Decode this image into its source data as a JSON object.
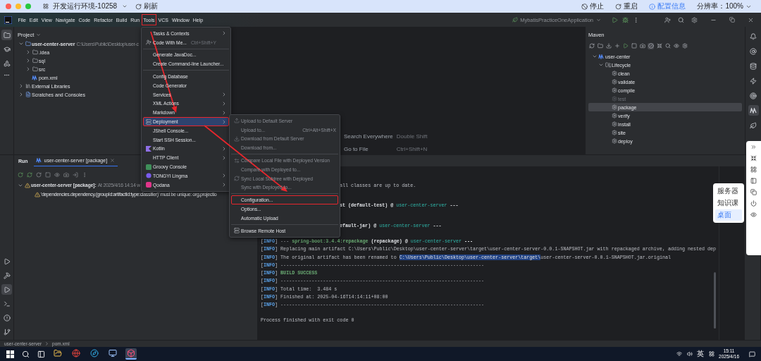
{
  "topbar": {
    "title": "开发运行环境-10258",
    "refresh": "刷新",
    "actions": [
      {
        "label": "停止",
        "kind": "stop"
      },
      {
        "label": "重启",
        "kind": "restart"
      },
      {
        "label": "配置信息",
        "kind": "info"
      }
    ],
    "resolution": "分辨率：100%"
  },
  "menubar": [
    {
      "label": "File",
      "highlighted": false
    },
    {
      "label": "Edit",
      "highlighted": false
    },
    {
      "label": "View",
      "highlighted": false
    },
    {
      "label": "Navigate",
      "highlighted": false
    },
    {
      "label": "Code",
      "highlighted": false
    },
    {
      "label": "Refactor",
      "highlighted": false
    },
    {
      "label": "Build",
      "highlighted": false
    },
    {
      "label": "Run",
      "highlighted": false
    },
    {
      "label": "Tools",
      "highlighted": true
    },
    {
      "label": "VCS",
      "highlighted": false
    },
    {
      "label": "Window",
      "highlighted": false
    },
    {
      "label": "Help",
      "highlighted": false
    }
  ],
  "run_config": "MybatisPracticeOneApplication",
  "left_tools": {
    "top": [
      {
        "selected": true
      },
      {
        "selected": false
      },
      {
        "selected": false
      }
    ],
    "bottom": [
      {
        "selected": false
      },
      {
        "selected": false
      },
      {
        "selected": true
      },
      {
        "selected": false
      },
      {
        "selected": false
      },
      {
        "selected": false
      }
    ]
  },
  "project": {
    "title": "Project",
    "tree": [
      {
        "label": "user-center-server",
        "hint": "C:\\Users\\Public\\Desktop\\user-c",
        "kind": "module",
        "expanded": true,
        "children": [
          {
            "label": ".idea",
            "kind": "folder",
            "expanded": false
          },
          {
            "label": "sql",
            "kind": "folder",
            "expanded": false
          },
          {
            "label": "src",
            "kind": "folder",
            "expanded": false
          },
          {
            "label": "pom.xml",
            "kind": "file"
          }
        ]
      },
      {
        "label": "External Libraries",
        "kind": "library",
        "expanded": false
      },
      {
        "label": "Scratches and Consoles",
        "kind": "scratches",
        "expanded": false
      }
    ]
  },
  "editor_hints": [
    {
      "action": "Search Everywhere",
      "shortcut": "Double Shift"
    },
    {
      "action": "Go to File",
      "shortcut": "Ctrl+Shift+N"
    }
  ],
  "maven": {
    "title": "Maven",
    "tree": [
      {
        "label": "user-center",
        "kind": "module",
        "expanded": true,
        "children": [
          {
            "label": "Lifecycle",
            "kind": "folder",
            "expanded": true,
            "children": [
              {
                "label": "clean",
                "kind": "goal",
                "selected": false,
                "disabled": false
              },
              {
                "label": "validate",
                "kind": "goal",
                "selected": false,
                "disabled": false
              },
              {
                "label": "compile",
                "kind": "goal",
                "selected": false,
                "disabled": false
              },
              {
                "label": "test",
                "kind": "goal",
                "selected": false,
                "disabled": true
              },
              {
                "label": "package",
                "kind": "goal",
                "selected": true,
                "disabled": false
              },
              {
                "label": "verify",
                "kind": "goal",
                "selected": false,
                "disabled": false
              },
              {
                "label": "install",
                "kind": "goal",
                "selected": false,
                "disabled": false
              },
              {
                "label": "site",
                "kind": "goal",
                "selected": false,
                "disabled": false
              },
              {
                "label": "deploy",
                "kind": "goal",
                "selected": false,
                "disabled": false
              }
            ]
          }
        ]
      }
    ]
  },
  "right_tools": [
    {
      "selected": false
    },
    {
      "selected": false
    },
    {
      "selected": false
    },
    {
      "selected": false
    },
    {
      "selected": false
    },
    {
      "selected": true
    },
    {
      "selected": false
    }
  ],
  "run": {
    "label": "Run",
    "tab": "user-center-server [package]",
    "tree": {
      "title": "user-center-server [package]:",
      "meta": "At 2025/4/16 14:14 w",
      "expanded": true,
      "children": [
        {
          "message": "'dependencies.dependency.(groupId:artifactId:type:classifier)' must be unique: org.projectio"
        }
      ]
    },
    "console": {
      "partial_lines": [
        [
          {
            "text": "all classes are up to date.",
            "kind": "plain"
          }
        ],
        [
          {
            "text": "st (default-test) @ ",
            "kind": "bold"
          },
          {
            "text": "user-center-server",
            "kind": "cyan"
          },
          {
            "text": " ---",
            "kind": "bold"
          }
        ],
        [
          {
            "text": "efault-jar) @ ",
            "kind": "bold"
          },
          {
            "text": "user-center-server",
            "kind": "cyan"
          },
          {
            "text": " ---",
            "kind": "bold"
          }
        ]
      ],
      "lines": [
        [
          {
            "text": "[",
            "kind": "plain"
          },
          {
            "text": "INFO",
            "kind": "tag"
          },
          {
            "text": "] --- ",
            "kind": "plain"
          },
          {
            "text": "spring-boot:3.4.4:repackage",
            "kind": "green"
          },
          {
            "text": " (repackage) @ ",
            "kind": "bold"
          },
          {
            "text": "user-center-server",
            "kind": "cyan"
          },
          {
            "text": " ---",
            "kind": "bold"
          }
        ],
        [
          {
            "text": "[",
            "kind": "plain"
          },
          {
            "text": "INFO",
            "kind": "tag"
          },
          {
            "text": "] Replacing main artifact C:\\Users\\Public\\Desktop\\user-center-server\\target\\user-center-server-0.0.1-SNAPSHOT.jar with repackaged archive, adding nested dep",
            "kind": "plain"
          }
        ],
        [
          {
            "text": "[",
            "kind": "plain"
          },
          {
            "text": "INFO",
            "kind": "tag"
          },
          {
            "text": "] The original artifact has been renamed to ",
            "kind": "plain"
          },
          {
            "text": "C:\\Users\\Public\\Desktop\\user-center-server\\target\\",
            "kind": "selected"
          },
          {
            "text": "user-center-server-0.0.1-SNAPSHOT.jar.original",
            "kind": "plain"
          }
        ],
        [
          {
            "text": "[",
            "kind": "plain"
          },
          {
            "text": "INFO",
            "kind": "tag"
          },
          {
            "text": "] ------------------------------------------------------------------------",
            "kind": "plain"
          }
        ],
        [
          {
            "text": "[",
            "kind": "plain"
          },
          {
            "text": "INFO",
            "kind": "tag"
          },
          {
            "text": "] ",
            "kind": "plain"
          },
          {
            "text": "BUILD SUCCESS",
            "kind": "green"
          }
        ],
        [
          {
            "text": "[",
            "kind": "plain"
          },
          {
            "text": "INFO",
            "kind": "tag"
          },
          {
            "text": "] ------------------------------------------------------------------------",
            "kind": "plain"
          }
        ],
        [
          {
            "text": "[",
            "kind": "plain"
          },
          {
            "text": "INFO",
            "kind": "tag"
          },
          {
            "text": "] Total time:  3.484 s",
            "kind": "plain"
          }
        ],
        [
          {
            "text": "[",
            "kind": "plain"
          },
          {
            "text": "INFO",
            "kind": "tag"
          },
          {
            "text": "] Finished at: 2025-04-16T14:14:11+08:00",
            "kind": "plain"
          }
        ],
        [
          {
            "text": "[",
            "kind": "plain"
          },
          {
            "text": "INFO",
            "kind": "tag"
          },
          {
            "text": "] ------------------------------------------------------------------------",
            "kind": "plain"
          }
        ]
      ],
      "exit": "Process finished with exit code 0"
    }
  },
  "tools_menu": [
    [
      {
        "label": "Tasks & Contexts",
        "submenu": true,
        "selected": false,
        "highlighted": false
      },
      {
        "label": "Code With Me...",
        "shortcut": "Ctrl+Shift+Y",
        "submenu": false,
        "selected": false,
        "highlighted": false
      }
    ],
    [
      {
        "label": "Generate JavaDoc...",
        "submenu": false,
        "selected": false,
        "highlighted": false
      },
      {
        "label": "Create Command-line Launcher...",
        "submenu": false,
        "selected": false,
        "highlighted": false
      }
    ],
    [
      {
        "label": "Config Database",
        "submenu": false,
        "selected": false,
        "highlighted": false
      },
      {
        "label": "Code Generator",
        "submenu": false,
        "selected": false,
        "highlighted": false
      },
      {
        "label": "Services",
        "submenu": true,
        "selected": false,
        "highlighted": false
      },
      {
        "label": "XML Actions",
        "submenu": true,
        "selected": false,
        "highlighted": false
      },
      {
        "label": "Markdown",
        "submenu": true,
        "selected": false,
        "highlighted": false
      },
      {
        "label": "Deployment",
        "submenu": true,
        "selected": true,
        "highlighted": true
      },
      {
        "label": "JShell Console...",
        "submenu": false,
        "selected": false,
        "highlighted": false
      },
      {
        "label": "Start SSH Session...",
        "submenu": false,
        "selected": false,
        "highlighted": false
      },
      {
        "label": "Kotlin",
        "submenu": true,
        "selected": false,
        "highlighted": false
      },
      {
        "label": "HTTP Client",
        "submenu": true,
        "selected": false,
        "highlighted": false
      },
      {
        "label": "Groovy Console",
        "submenu": false,
        "selected": false,
        "highlighted": false
      },
      {
        "label": "TONGYI Lingma",
        "submenu": true,
        "selected": false,
        "highlighted": false
      },
      {
        "label": "Qodana",
        "submenu": true,
        "selected": false,
        "highlighted": false
      }
    ]
  ],
  "deployment_menu": [
    [
      {
        "label": "Upload to Default Server",
        "disabled": true,
        "highlighted": false
      },
      {
        "label": "Upload to...",
        "shortcut": "Ctrl+Alt+Shift+X",
        "disabled": true,
        "highlighted": false
      },
      {
        "label": "Download from Default Server",
        "disabled": true,
        "highlighted": false
      },
      {
        "label": "Download from...",
        "disabled": true,
        "highlighted": false
      }
    ],
    [
      {
        "label": "Compare Local File with Deployed Version",
        "disabled": true,
        "highlighted": false
      },
      {
        "label": "Compare with Deployed to...",
        "disabled": true,
        "highlighted": false
      },
      {
        "label": "Sync Local Subtree with Deployed",
        "disabled": true,
        "highlighted": false
      },
      {
        "label": "Sync with Deployed to...",
        "disabled": true,
        "highlighted": false
      }
    ],
    [
      {
        "label": "Configuration...",
        "disabled": false,
        "highlighted": true
      },
      {
        "label": "Options...",
        "disabled": false,
        "highlighted": false
      },
      {
        "label": "Automatic Upload",
        "disabled": false,
        "highlighted": false
      }
    ],
    [
      {
        "label": "Browse Remote Host",
        "disabled": false,
        "highlighted": false
      }
    ]
  ],
  "side_popup": [
    {
      "label": "服务器",
      "selected": false
    },
    {
      "label": "知识课",
      "selected": false
    },
    {
      "label": "桌面",
      "selected": true
    }
  ],
  "status_bar": [
    "user-center-server",
    "pom.xml"
  ],
  "taskbar": {
    "apps": [
      {
        "selected": false
      },
      {
        "selected": false
      },
      {
        "selected": false
      },
      {
        "selected": false
      },
      {
        "selected": true
      }
    ],
    "language": "英",
    "time": "15:11",
    "date": "2025/4/16"
  }
}
